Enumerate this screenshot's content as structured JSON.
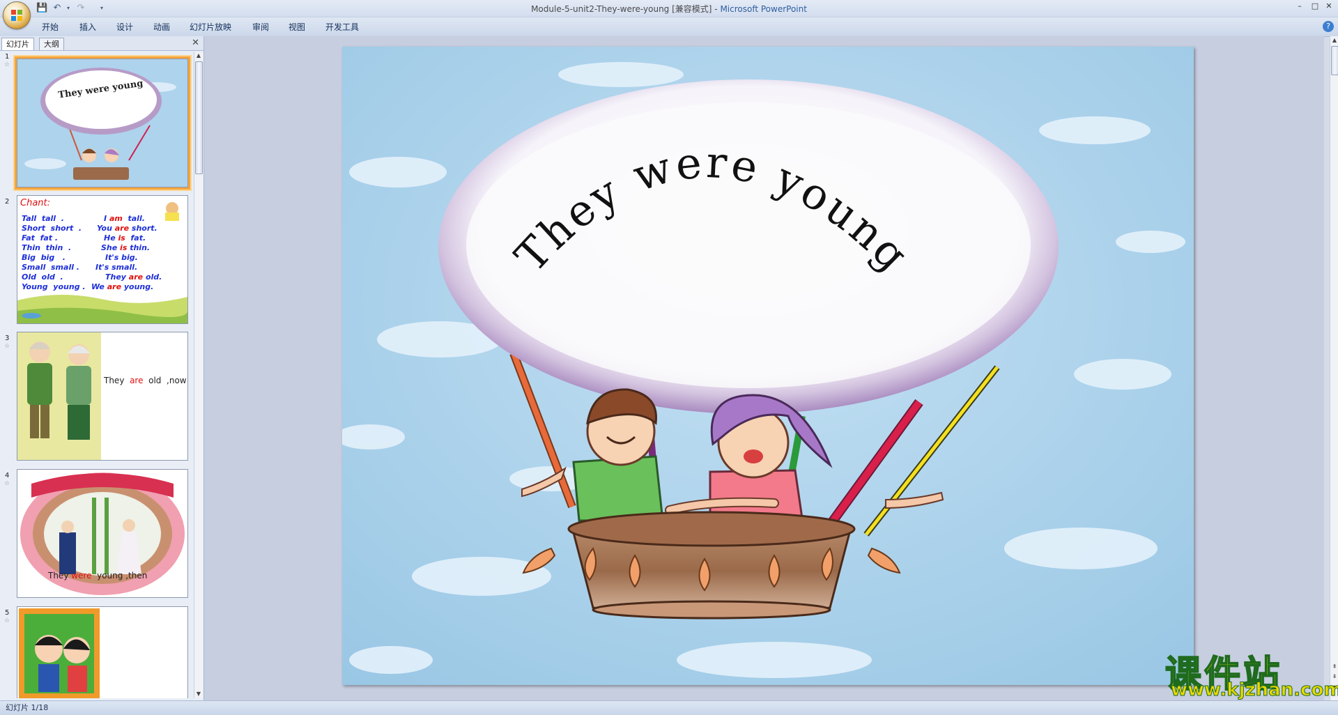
{
  "window": {
    "title": "Module-5-unit2-They-were-young [兼容模式] - ",
    "app_name": "Microsoft PowerPoint"
  },
  "ribbon": {
    "tabs": [
      "开始",
      "插入",
      "设计",
      "动画",
      "幻灯片放映",
      "审阅",
      "视图",
      "开发工具"
    ]
  },
  "pane": {
    "tab_slides": "幻灯片",
    "tab_outline": "大纲"
  },
  "thumbnails": {
    "numbers": [
      "1",
      "2",
      "3",
      "4",
      "5"
    ],
    "slide1_title": "They were young",
    "slide2": {
      "heading": "Chant:",
      "lines": [
        {
          "left": "Tall  tall  .",
          "pre": "I ",
          "verb": "am",
          "post": "  tall."
        },
        {
          "left": "Short  short  .",
          "pre": "You ",
          "verb": "are",
          "post": " short."
        },
        {
          "left": "Fat  fat .",
          "pre": "He ",
          "verb": "is",
          "post": "  fat."
        },
        {
          "left": "Thin  thin  .",
          "pre": "She ",
          "verb": "is",
          "post": " thin."
        },
        {
          "left": "Big  big   .",
          "pre": "It's big.",
          "verb": "",
          "post": ""
        },
        {
          "left": "Small  small .",
          "pre": "It's small.",
          "verb": "",
          "post": ""
        },
        {
          "left": "Old  old  .",
          "pre": "They ",
          "verb": "are",
          "post": " old."
        },
        {
          "left": "Young  young .",
          "pre": "We ",
          "verb": "are",
          "post": " young."
        }
      ]
    },
    "slide3": {
      "pre": "They  ",
      "verb": "are",
      "post": "  old  ,now"
    },
    "slide4": {
      "pre": "They ",
      "verb": "were",
      "post": "  young ,then"
    }
  },
  "slide": {
    "title": "They were young"
  },
  "status": {
    "slide_position": "幻灯片 1/18"
  },
  "watermark": {
    "line1": "课件站",
    "line2": "www.kjzhan.com"
  },
  "colors": {
    "sky": "#aed3ec",
    "balloon_rim": "#b69bc7",
    "accent_red": "#e01010",
    "chant_blue": "#1d2fd8"
  }
}
